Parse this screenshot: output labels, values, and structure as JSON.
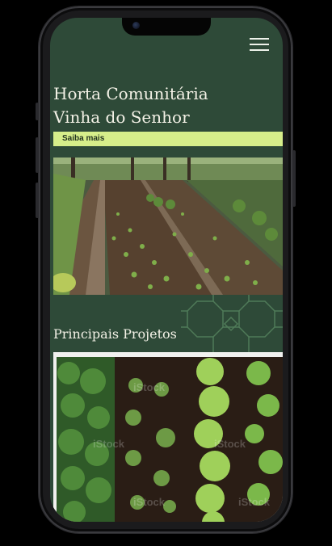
{
  "header": {
    "title_line1": "Horta Comunitária",
    "title_line2": "Vinha do Senhor",
    "menu_icon": "hamburger-menu-icon"
  },
  "hero": {
    "cta_label": "Saiba mais"
  },
  "projects": {
    "section_title": "Principais Projetos",
    "watermark_text": "iStock"
  },
  "colors": {
    "background": "#2e4a38",
    "accent": "#d6ee8a",
    "text": "#f3f1e6"
  }
}
